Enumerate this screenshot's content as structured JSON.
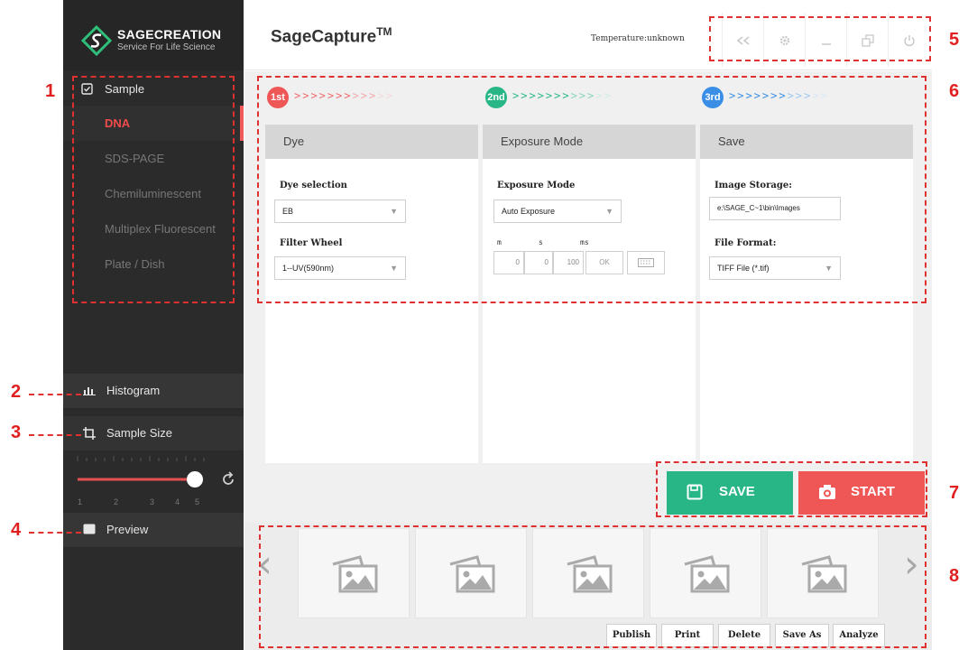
{
  "brand": {
    "name": "SAGECREATION",
    "tagline": "Service For Life Science"
  },
  "sidebar": {
    "group_label": "Sample",
    "items": [
      {
        "label": "DNA",
        "active": true
      },
      {
        "label": "SDS-PAGE"
      },
      {
        "label": "Chemiluminescent"
      },
      {
        "label": "Multiplex Fluorescent"
      },
      {
        "label": "Plate / Dish"
      }
    ],
    "histogram_label": "Histogram",
    "sample_size_label": "Sample Size",
    "slider": {
      "ticks": [
        "1",
        "2",
        "3",
        "4",
        "5"
      ],
      "value": 5
    },
    "preview_label": "Preview"
  },
  "header": {
    "title": "SageCapture",
    "trademark": "TM",
    "temperature": "Temperature:unknown",
    "window_buttons": [
      "back-icon",
      "settings-icon",
      "minimize-icon",
      "restore-icon",
      "power-icon"
    ]
  },
  "steps": [
    {
      "badge": "1st",
      "color": "#ef5656"
    },
    {
      "badge": "2nd",
      "color": "#29b687"
    },
    {
      "badge": "3rd",
      "color": "#3a8ee6"
    }
  ],
  "panels": {
    "dye": {
      "title": "Dye",
      "dye_selection_label": "Dye selection",
      "dye_value": "EB",
      "filter_wheel_label": "Filter Wheel",
      "filter_value": "1--UV(590nm)"
    },
    "exposure": {
      "title": "Exposure Mode",
      "mode_label": "Exposure Mode",
      "mode_value": "Auto Exposure",
      "unit_m": "m",
      "unit_s": "s",
      "unit_ms": "ms",
      "m_value": "0",
      "s_value": "0",
      "ms_value": "100",
      "ok_label": "OK"
    },
    "save": {
      "title": "Save",
      "storage_label": "Image Storage:",
      "storage_value": "e:\\SAGE_C~1\\bin\\Images",
      "format_label": "File Format:",
      "format_value": "TIFF File (*.tif)"
    }
  },
  "actions": {
    "save_label": "SAVE",
    "start_label": "START"
  },
  "gallery": {
    "thumb_count": 5,
    "buttons": [
      "Publish",
      "Print",
      "Delete",
      "Save As",
      "Analyze"
    ]
  },
  "annotations": [
    "1",
    "2",
    "3",
    "4",
    "5",
    "6",
    "7",
    "8"
  ],
  "colors": {
    "accent_red": "#ef5656",
    "accent_green": "#29b687",
    "accent_blue": "#3a8ee6",
    "sidebar_bg": "#2b2b2b",
    "annotation": "#e02020"
  }
}
